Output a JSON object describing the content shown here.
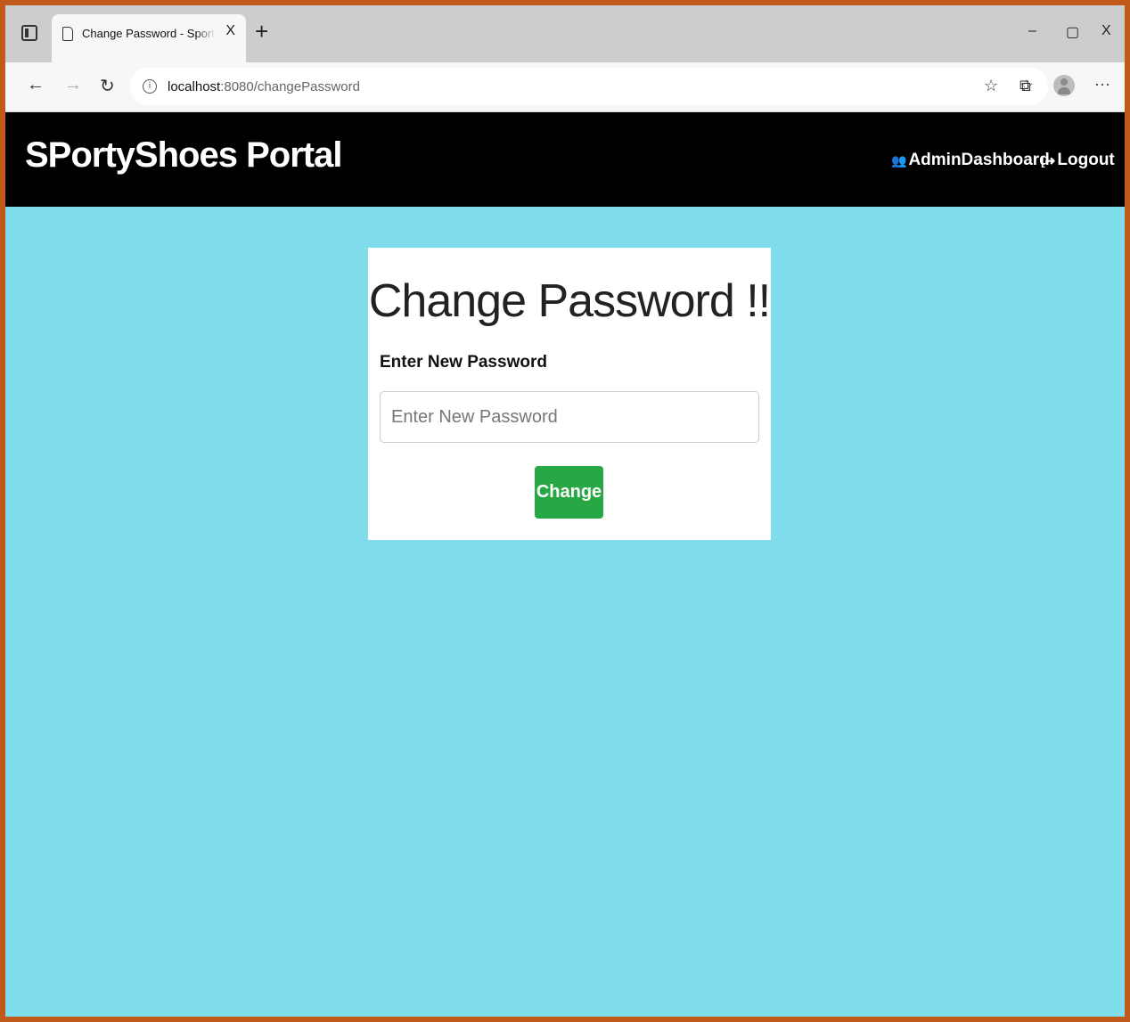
{
  "browser": {
    "tab_title": "Change Password - SportyShoes",
    "tab_close": "X",
    "new_tab": "+",
    "window_minimize": "–",
    "window_restore": "▢",
    "window_close": "X",
    "url_host": "localhost",
    "url_rest": ":8080/changePassword",
    "more_menu": "···"
  },
  "navbar": {
    "brand": "SPortyShoes Portal",
    "admin_dashboard": "AdminDashboard",
    "logout": "Logout"
  },
  "form": {
    "heading": "Change Password !!",
    "label": "Enter New Password",
    "placeholder": "Enter New Password",
    "value": "",
    "submit": "Change"
  },
  "colors": {
    "page_background": "#7fdcea",
    "navbar": "#000000",
    "button": "#28a745",
    "frame_border": "#c0591a"
  },
  "icons": {
    "tab_actions": "tab-actions-icon",
    "page": "page-icon",
    "back": "back-arrow-icon",
    "forward": "forward-arrow-icon",
    "refresh": "refresh-icon",
    "info": "info-icon",
    "add_favorite": "star-add-icon",
    "favorites": "favorites-icon",
    "collections": "collections-icon",
    "profile": "profile-avatar-icon",
    "users": "users-icon",
    "logout": "sign-out-icon"
  }
}
